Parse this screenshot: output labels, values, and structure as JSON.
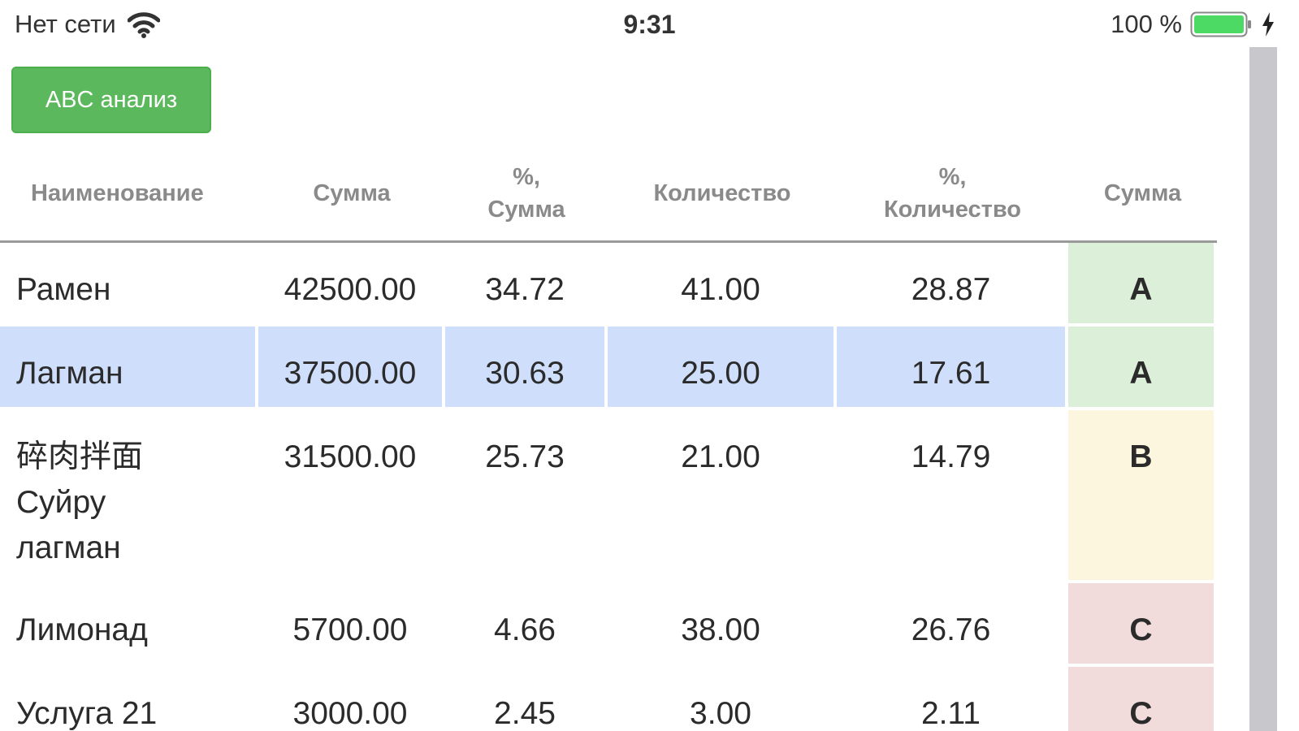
{
  "status_bar": {
    "carrier": "Нет сети",
    "time": "9:31",
    "battery": "100 %",
    "battery_color": "#4cd964"
  },
  "toolbar": {
    "abc_button_label": "ABC анализ"
  },
  "colors": {
    "button_green": "#5cb85c",
    "selected_row": "#cfdffb",
    "class_A": "#dcefd9",
    "class_B": "#fdf6df",
    "class_C": "#f1dcdb"
  },
  "table": {
    "headers": [
      {
        "line1": "Наименование",
        "line2": ""
      },
      {
        "line1": "Сумма",
        "line2": ""
      },
      {
        "line1": "%,",
        "line2": "Сумма"
      },
      {
        "line1": "Количество",
        "line2": ""
      },
      {
        "line1": "%,",
        "line2": "Количество"
      },
      {
        "line1": "Сумма",
        "line2": ""
      }
    ],
    "rows": [
      {
        "name_lines": [
          "Рамен"
        ],
        "sum": "42500.00",
        "pct_sum": "34.72",
        "qty": "41.00",
        "pct_qty": "28.87",
        "cls": "A",
        "selected": false
      },
      {
        "name_lines": [
          "Лагман"
        ],
        "sum": "37500.00",
        "pct_sum": "30.63",
        "qty": "25.00",
        "pct_qty": "17.61",
        "cls": "A",
        "selected": true
      },
      {
        "name_lines": [
          "碎肉拌面",
          "Суйру",
          "лагман"
        ],
        "sum": "31500.00",
        "pct_sum": "25.73",
        "qty": "21.00",
        "pct_qty": "14.79",
        "cls": "B",
        "selected": false
      },
      {
        "name_lines": [
          "Лимонад"
        ],
        "sum": "5700.00",
        "pct_sum": "4.66",
        "qty": "38.00",
        "pct_qty": "26.76",
        "cls": "C",
        "selected": false
      },
      {
        "name_lines": [
          "Услуга 21"
        ],
        "sum": "3000.00",
        "pct_sum": "2.45",
        "qty": "3.00",
        "pct_qty": "2.11",
        "cls": "C",
        "selected": false
      }
    ]
  }
}
